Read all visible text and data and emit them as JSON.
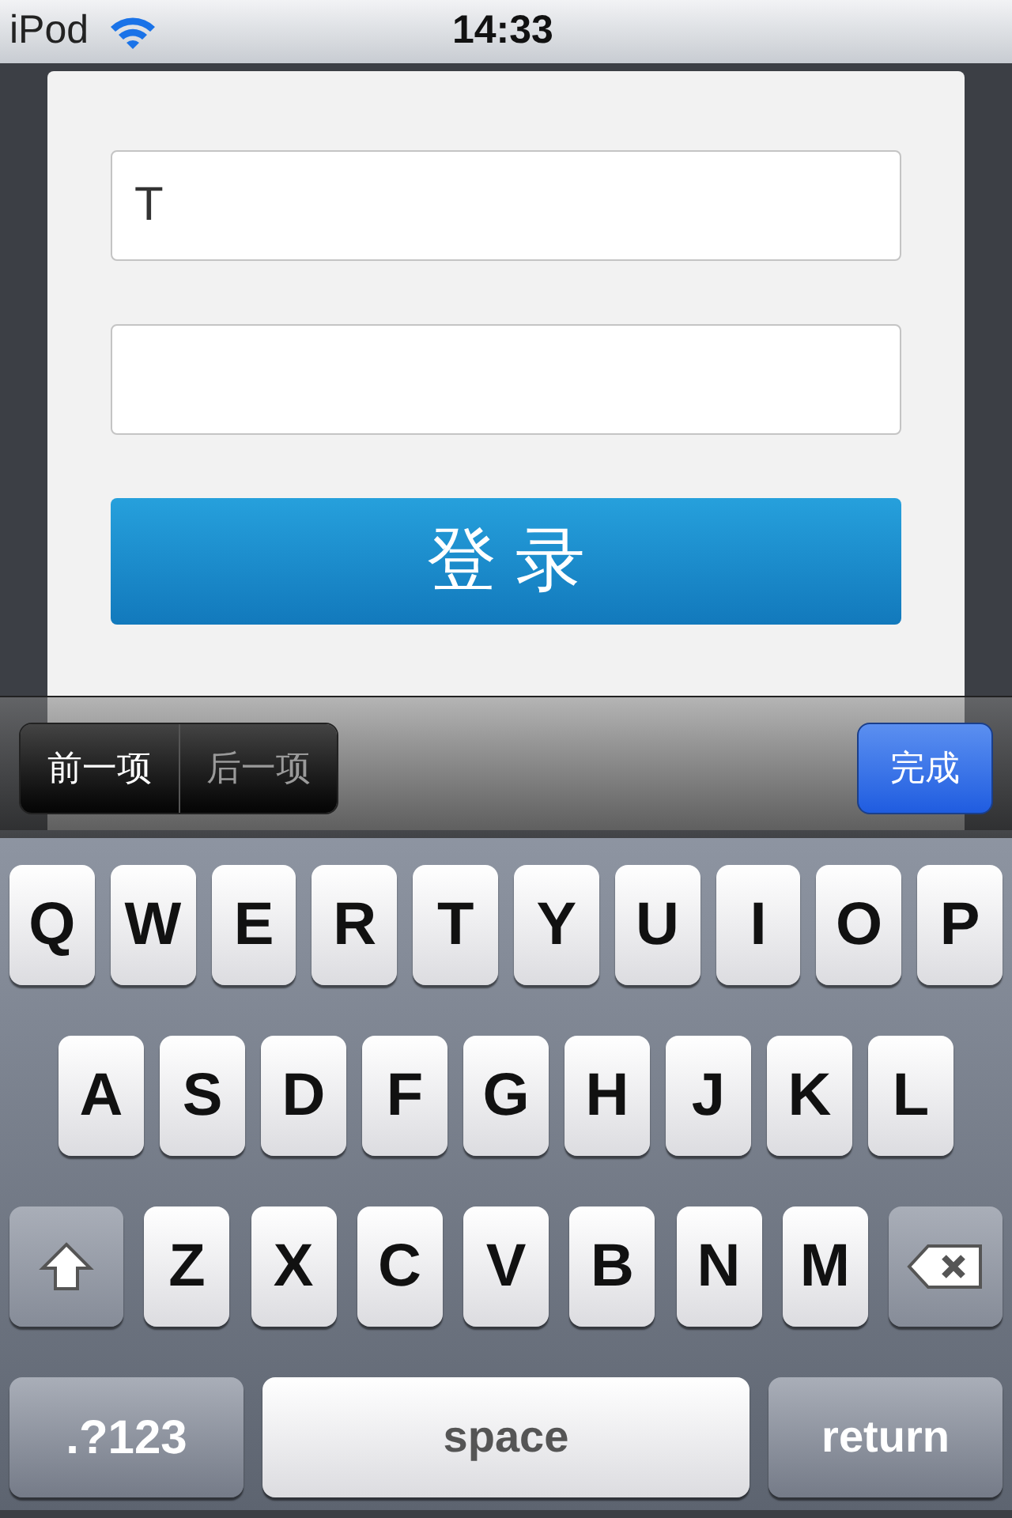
{
  "status_bar": {
    "device": "iPod",
    "time": "14:33"
  },
  "form": {
    "fields": [
      {
        "kind": "text",
        "value": "T"
      },
      {
        "kind": "password"
      }
    ],
    "login_button": "登 录"
  },
  "toolbar": {
    "nav": [
      {
        "label": "前一项",
        "disabled": false
      },
      {
        "label": "后一项",
        "disabled": true
      }
    ],
    "done": "完成"
  },
  "keyboard": {
    "rows": [
      {
        "keys": [
          {
            "kind": "letter",
            "label": "Q"
          },
          {
            "kind": "letter",
            "label": "W"
          },
          {
            "kind": "letter",
            "label": "E"
          },
          {
            "kind": "letter",
            "label": "R"
          },
          {
            "kind": "letter",
            "label": "T"
          },
          {
            "kind": "letter",
            "label": "Y"
          },
          {
            "kind": "letter",
            "label": "U"
          },
          {
            "kind": "letter",
            "label": "I"
          },
          {
            "kind": "letter",
            "label": "O"
          },
          {
            "kind": "letter",
            "label": "P"
          }
        ]
      },
      {
        "keys": [
          {
            "kind": "letter",
            "label": "A"
          },
          {
            "kind": "letter",
            "label": "S"
          },
          {
            "kind": "letter",
            "label": "D"
          },
          {
            "kind": "letter",
            "label": "F"
          },
          {
            "kind": "letter",
            "label": "G"
          },
          {
            "kind": "letter",
            "label": "H"
          },
          {
            "kind": "letter",
            "label": "J"
          },
          {
            "kind": "letter",
            "label": "K"
          },
          {
            "kind": "letter",
            "label": "L"
          }
        ]
      },
      {
        "keys": [
          {
            "kind": "shift"
          },
          {
            "kind": "letter",
            "label": "Z"
          },
          {
            "kind": "letter",
            "label": "X"
          },
          {
            "kind": "letter",
            "label": "C"
          },
          {
            "kind": "letter",
            "label": "V"
          },
          {
            "kind": "letter",
            "label": "B"
          },
          {
            "kind": "letter",
            "label": "N"
          },
          {
            "kind": "letter",
            "label": "M"
          },
          {
            "kind": "delete"
          }
        ]
      },
      {
        "keys": [
          {
            "kind": "mode",
            "label": ".?123"
          },
          {
            "kind": "space",
            "label": "space"
          },
          {
            "kind": "return",
            "label": "return"
          }
        ]
      }
    ]
  }
}
